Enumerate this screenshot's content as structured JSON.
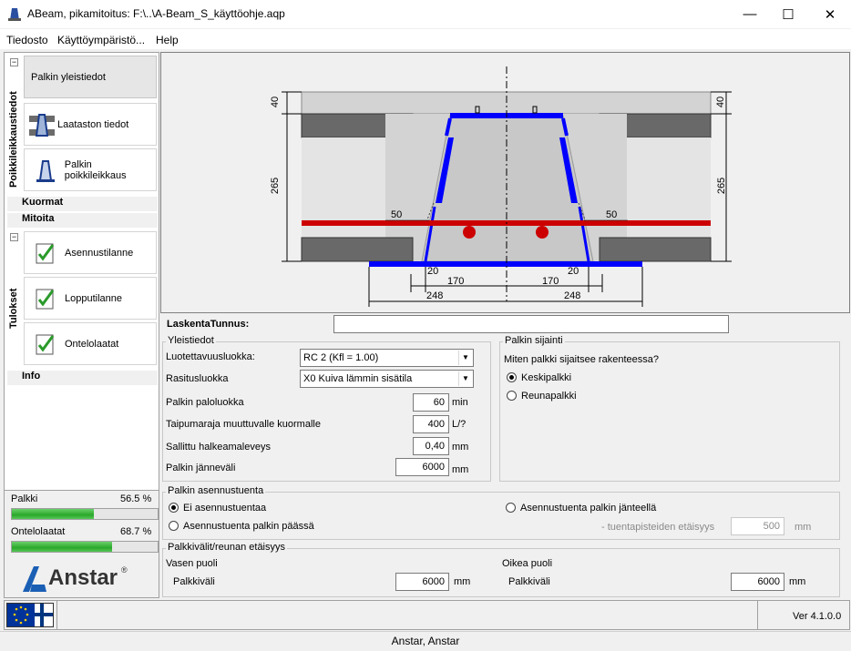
{
  "window": {
    "title": "ABeam, pikamitoitus:  F:\\..\\A-Beam_S_käyttöohje.aqp"
  },
  "menu": {
    "items": [
      "Tiedosto",
      "Käyttöympäristö...",
      "Help"
    ]
  },
  "sidebar": {
    "group1_tab": "Poikkileikkaustiedot",
    "group2_tab": "Tulokset",
    "nav": [
      {
        "label": "Palkin yleistiedot"
      },
      {
        "label": "Laataston tiedot"
      },
      {
        "label": "Palkin poikkileikkaus"
      },
      {
        "label": "Asennustilanne"
      },
      {
        "label": "Lopputilanne"
      },
      {
        "label": "Ontelolaatat"
      }
    ],
    "sections": {
      "kuormat": "Kuormat",
      "mitoita": "Mitoita",
      "info": "Info"
    },
    "collapse_symbol": "−"
  },
  "progress": [
    {
      "label": "Palkki",
      "value": "56.5 %",
      "fraction": 0.565
    },
    {
      "label": "Ontelolaatat",
      "value": "68.7 %",
      "fraction": 0.687
    }
  ],
  "logo": {
    "text": "Anstar",
    "mark": "®"
  },
  "drawing": {
    "dims": {
      "top_left": "40",
      "top_right": "40",
      "height_left": "265",
      "height_right": "265",
      "left_50": "50",
      "right_50": "50",
      "left_20": "20",
      "right_20": "20",
      "left_170": "170",
      "right_170": "170",
      "left_248": "248",
      "right_248": "248"
    },
    "colors": {
      "steel": "#0000ff",
      "rebar": "#cc0000",
      "concrete": "#d3d3d3",
      "slab": "#696969"
    }
  },
  "form": {
    "laskenta_label": "LaskentaTunnus:",
    "laskenta_value": "",
    "yleistiedot": {
      "title": "Yleistiedot",
      "luotettavuus_label": "Luotettavuusluokka:",
      "luotettavuus_value": "RC 2  (Kfl = 1.00)",
      "rasitus_label": "Rasitusluokka",
      "rasitus_value": "X0  Kuiva lämmin sisätila",
      "palo_label": "Palkin paloluokka",
      "palo_value": "60",
      "palo_unit": "min",
      "taipuma_label": "Taipumaraja muuttuvalle kuormalle",
      "taipuma_value": "400",
      "taipuma_unit": "L/?",
      "halkeama_label": "Sallittu halkeamaleveys",
      "halkeama_value": "0,40",
      "halkeama_unit": "mm",
      "janneva_label": "Palkin jänneväli",
      "janneva_value": "6000",
      "janneva_unit": "mm"
    },
    "sijainti": {
      "title": "Palkin sijainti",
      "question": "Miten palkki sijaitsee rakenteessa?",
      "options": [
        "Keskipalkki",
        "Reunapalkki"
      ],
      "selected": "Keskipalkki"
    },
    "asennustuenta": {
      "title": "Palkin asennustuenta",
      "opt1": "Ei asennustuentaa",
      "opt2": "Asennustuenta palkin päässä",
      "opt3": "Asennustuenta palkin jänteellä",
      "selected": "Ei asennustuentaa",
      "tuenta_label": "- tuentapisteiden etäisyys",
      "tuenta_value": "500",
      "tuenta_unit": "mm"
    },
    "palkkivalit": {
      "title": "Palkkivälit/reunan etäisyys",
      "left_title": "Vasen puoli",
      "right_title": "Oikea puoli",
      "left_label": "Palkkiväli",
      "left_value": "6000",
      "left_unit": "mm",
      "right_label": "Palkkiväli",
      "right_value": "6000",
      "right_unit": "mm"
    }
  },
  "status": {
    "version": "Ver 4.1.0.0"
  },
  "footer": {
    "text": "Anstar, Anstar"
  }
}
